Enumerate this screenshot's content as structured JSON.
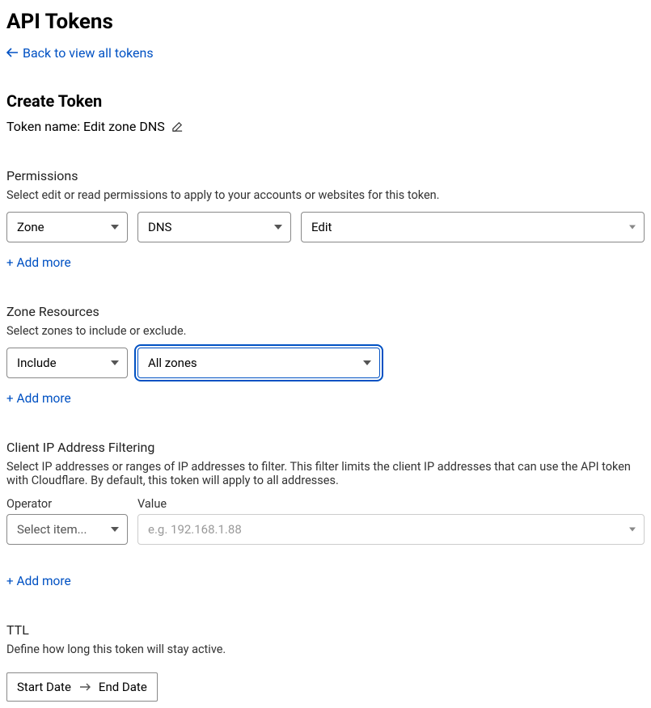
{
  "page_title": "API Tokens",
  "back_link": "Back to view all tokens",
  "create_heading": "Create Token",
  "token_name_label": "Token name:",
  "token_name_value": "Edit zone DNS",
  "permissions": {
    "title": "Permissions",
    "desc": "Select edit or read permissions to apply to your accounts or websites for this token.",
    "scope": "Zone",
    "resource": "DNS",
    "access": "Edit",
    "add_more": "Add more"
  },
  "zone_resources": {
    "title": "Zone Resources",
    "desc": "Select zones to include or exclude.",
    "mode": "Include",
    "selection": "All zones",
    "add_more": "Add more"
  },
  "ip_filter": {
    "title": "Client IP Address Filtering",
    "desc": "Select IP addresses or ranges of IP addresses to filter. This filter limits the client IP addresses that can use the API token with Cloudflare. By default, this token will apply to all addresses.",
    "operator_label": "Operator",
    "value_label": "Value",
    "operator_placeholder": "Select item...",
    "value_placeholder": "e.g. 192.168.1.88",
    "add_more": "Add more"
  },
  "ttl": {
    "title": "TTL",
    "desc": "Define how long this token will stay active.",
    "start": "Start Date",
    "end": "End Date"
  }
}
